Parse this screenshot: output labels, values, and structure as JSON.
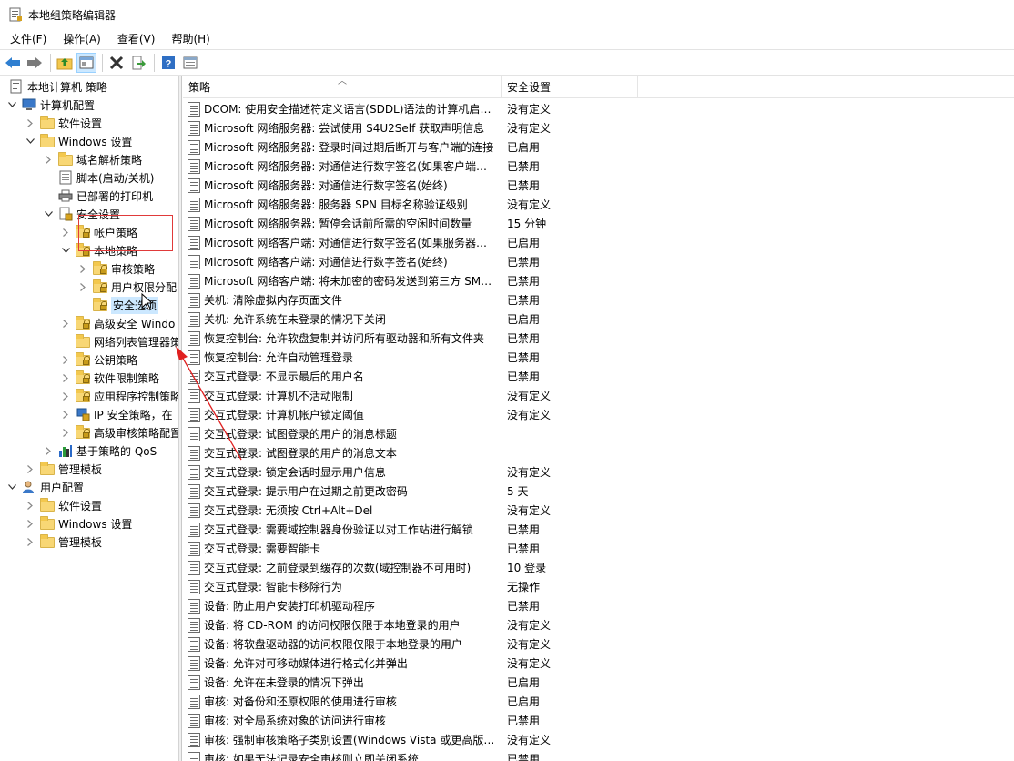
{
  "window": {
    "title": "本地组策略编辑器"
  },
  "menu": [
    "文件(F)",
    "操作(A)",
    "查看(V)",
    "帮助(H)"
  ],
  "toolbar": {
    "buttons": [
      "back-icon",
      "forward-icon",
      "up-folder-icon",
      "show-hide-tree-icon",
      "delete-icon",
      "export-list-icon",
      "help-icon",
      "properties-icon"
    ]
  },
  "tree": [
    {
      "label": "本地计算机 策略",
      "level": 0,
      "icon": "computer-policy-icon",
      "expand": "none"
    },
    {
      "label": "计算机配置",
      "level": 0,
      "icon": "computer-icon",
      "expand": "open"
    },
    {
      "label": "软件设置",
      "level": 1,
      "icon": "folder-icon",
      "expand": "closed"
    },
    {
      "label": "Windows 设置",
      "level": 1,
      "icon": "folder-icon",
      "expand": "open"
    },
    {
      "label": "域名解析策略",
      "level": 2,
      "icon": "folder-icon",
      "expand": "closed"
    },
    {
      "label": "脚本(启动/关机)",
      "level": 2,
      "icon": "script-icon",
      "expand": "none"
    },
    {
      "label": "已部署的打印机",
      "level": 2,
      "icon": "printer-icon",
      "expand": "none"
    },
    {
      "label": "安全设置",
      "level": 2,
      "icon": "security-icon",
      "expand": "open"
    },
    {
      "label": "帐户策略",
      "level": 3,
      "icon": "lock-folder-icon",
      "expand": "closed"
    },
    {
      "label": "本地策略",
      "level": 3,
      "icon": "lock-folder-icon",
      "expand": "open"
    },
    {
      "label": "审核策略",
      "level": 4,
      "icon": "lock-folder-icon",
      "expand": "closed"
    },
    {
      "label": "用户权限分配",
      "level": 4,
      "icon": "lock-folder-icon",
      "expand": "closed"
    },
    {
      "label": "安全选项",
      "level": 4,
      "icon": "lock-folder-icon",
      "expand": "none",
      "selected": true
    },
    {
      "label": "高级安全 Windo",
      "level": 3,
      "icon": "lock-folder-icon",
      "expand": "closed"
    },
    {
      "label": "网络列表管理器策",
      "level": 3,
      "icon": "folder-icon",
      "expand": "none"
    },
    {
      "label": "公钥策略",
      "level": 3,
      "icon": "lock-folder-icon",
      "expand": "closed"
    },
    {
      "label": "软件限制策略",
      "level": 3,
      "icon": "lock-folder-icon",
      "expand": "closed"
    },
    {
      "label": "应用程序控制策略",
      "level": 3,
      "icon": "lock-folder-icon",
      "expand": "closed"
    },
    {
      "label": "IP 安全策略，在",
      "level": 3,
      "icon": "ip-security-icon",
      "expand": "closed"
    },
    {
      "label": "高级审核策略配置",
      "level": 3,
      "icon": "lock-folder-icon",
      "expand": "closed"
    },
    {
      "label": "基于策略的 QoS",
      "level": 2,
      "icon": "qos-chart-icon",
      "expand": "closed"
    },
    {
      "label": "管理模板",
      "level": 1,
      "icon": "folder-icon",
      "expand": "closed"
    },
    {
      "label": "用户配置",
      "level": 0,
      "icon": "user-icon",
      "expand": "open"
    },
    {
      "label": "软件设置",
      "level": 1,
      "icon": "folder-icon",
      "expand": "closed"
    },
    {
      "label": "Windows 设置",
      "level": 1,
      "icon": "folder-icon",
      "expand": "closed"
    },
    {
      "label": "管理模板",
      "level": 1,
      "icon": "folder-icon",
      "expand": "closed"
    }
  ],
  "list": {
    "col_policy": "策略",
    "col_setting": "安全设置",
    "rows": [
      [
        "DCOM: 使用安全描述符定义语言(SDDL)语法的计算机启动...",
        "没有定义"
      ],
      [
        "Microsoft 网络服务器: 尝试使用 S4U2Self 获取声明信息",
        "没有定义"
      ],
      [
        "Microsoft 网络服务器: 登录时间过期后断开与客户端的连接",
        "已启用"
      ],
      [
        "Microsoft 网络服务器: 对通信进行数字签名(如果客户端允...",
        "已禁用"
      ],
      [
        "Microsoft 网络服务器: 对通信进行数字签名(始终)",
        "已禁用"
      ],
      [
        "Microsoft 网络服务器: 服务器 SPN 目标名称验证级别",
        "没有定义"
      ],
      [
        "Microsoft 网络服务器: 暂停会话前所需的空闲时间数量",
        "15 分钟"
      ],
      [
        "Microsoft 网络客户端: 对通信进行数字签名(如果服务器允...",
        "已启用"
      ],
      [
        "Microsoft 网络客户端: 对通信进行数字签名(始终)",
        "已禁用"
      ],
      [
        "Microsoft 网络客户端: 将未加密的密码发送到第三方 SMB...",
        "已禁用"
      ],
      [
        "关机: 清除虚拟内存页面文件",
        "已禁用"
      ],
      [
        "关机: 允许系统在未登录的情况下关闭",
        "已启用"
      ],
      [
        "恢复控制台: 允许软盘复制并访问所有驱动器和所有文件夹",
        "已禁用"
      ],
      [
        "恢复控制台: 允许自动管理登录",
        "已禁用"
      ],
      [
        "交互式登录: 不显示最后的用户名",
        "已禁用"
      ],
      [
        "交互式登录: 计算机不活动限制",
        "没有定义"
      ],
      [
        "交互式登录: 计算机帐户锁定阈值",
        "没有定义"
      ],
      [
        "交互式登录: 试图登录的用户的消息标题",
        ""
      ],
      [
        "交互式登录: 试图登录的用户的消息文本",
        ""
      ],
      [
        "交互式登录: 锁定会话时显示用户信息",
        "没有定义"
      ],
      [
        "交互式登录: 提示用户在过期之前更改密码",
        "5 天"
      ],
      [
        "交互式登录: 无须按 Ctrl+Alt+Del",
        "没有定义"
      ],
      [
        "交互式登录: 需要域控制器身份验证以对工作站进行解锁",
        "已禁用"
      ],
      [
        "交互式登录: 需要智能卡",
        "已禁用"
      ],
      [
        "交互式登录: 之前登录到缓存的次数(域控制器不可用时)",
        "10 登录"
      ],
      [
        "交互式登录: 智能卡移除行为",
        "无操作"
      ],
      [
        "设备: 防止用户安装打印机驱动程序",
        "已禁用"
      ],
      [
        "设备: 将 CD-ROM 的访问权限仅限于本地登录的用户",
        "没有定义"
      ],
      [
        "设备: 将软盘驱动器的访问权限仅限于本地登录的用户",
        "没有定义"
      ],
      [
        "设备: 允许对可移动媒体进行格式化并弹出",
        "没有定义"
      ],
      [
        "设备: 允许在未登录的情况下弹出",
        "已启用"
      ],
      [
        "审核: 对备份和还原权限的使用进行审核",
        "已启用"
      ],
      [
        "审核: 对全局系统对象的访问进行审核",
        "已禁用"
      ],
      [
        "审核: 强制审核策略子类别设置(Windows Vista 或更高版本...",
        "没有定义"
      ],
      [
        "审核: 如果无法记录安全审核则立即关闭系统",
        "已禁用"
      ]
    ]
  }
}
